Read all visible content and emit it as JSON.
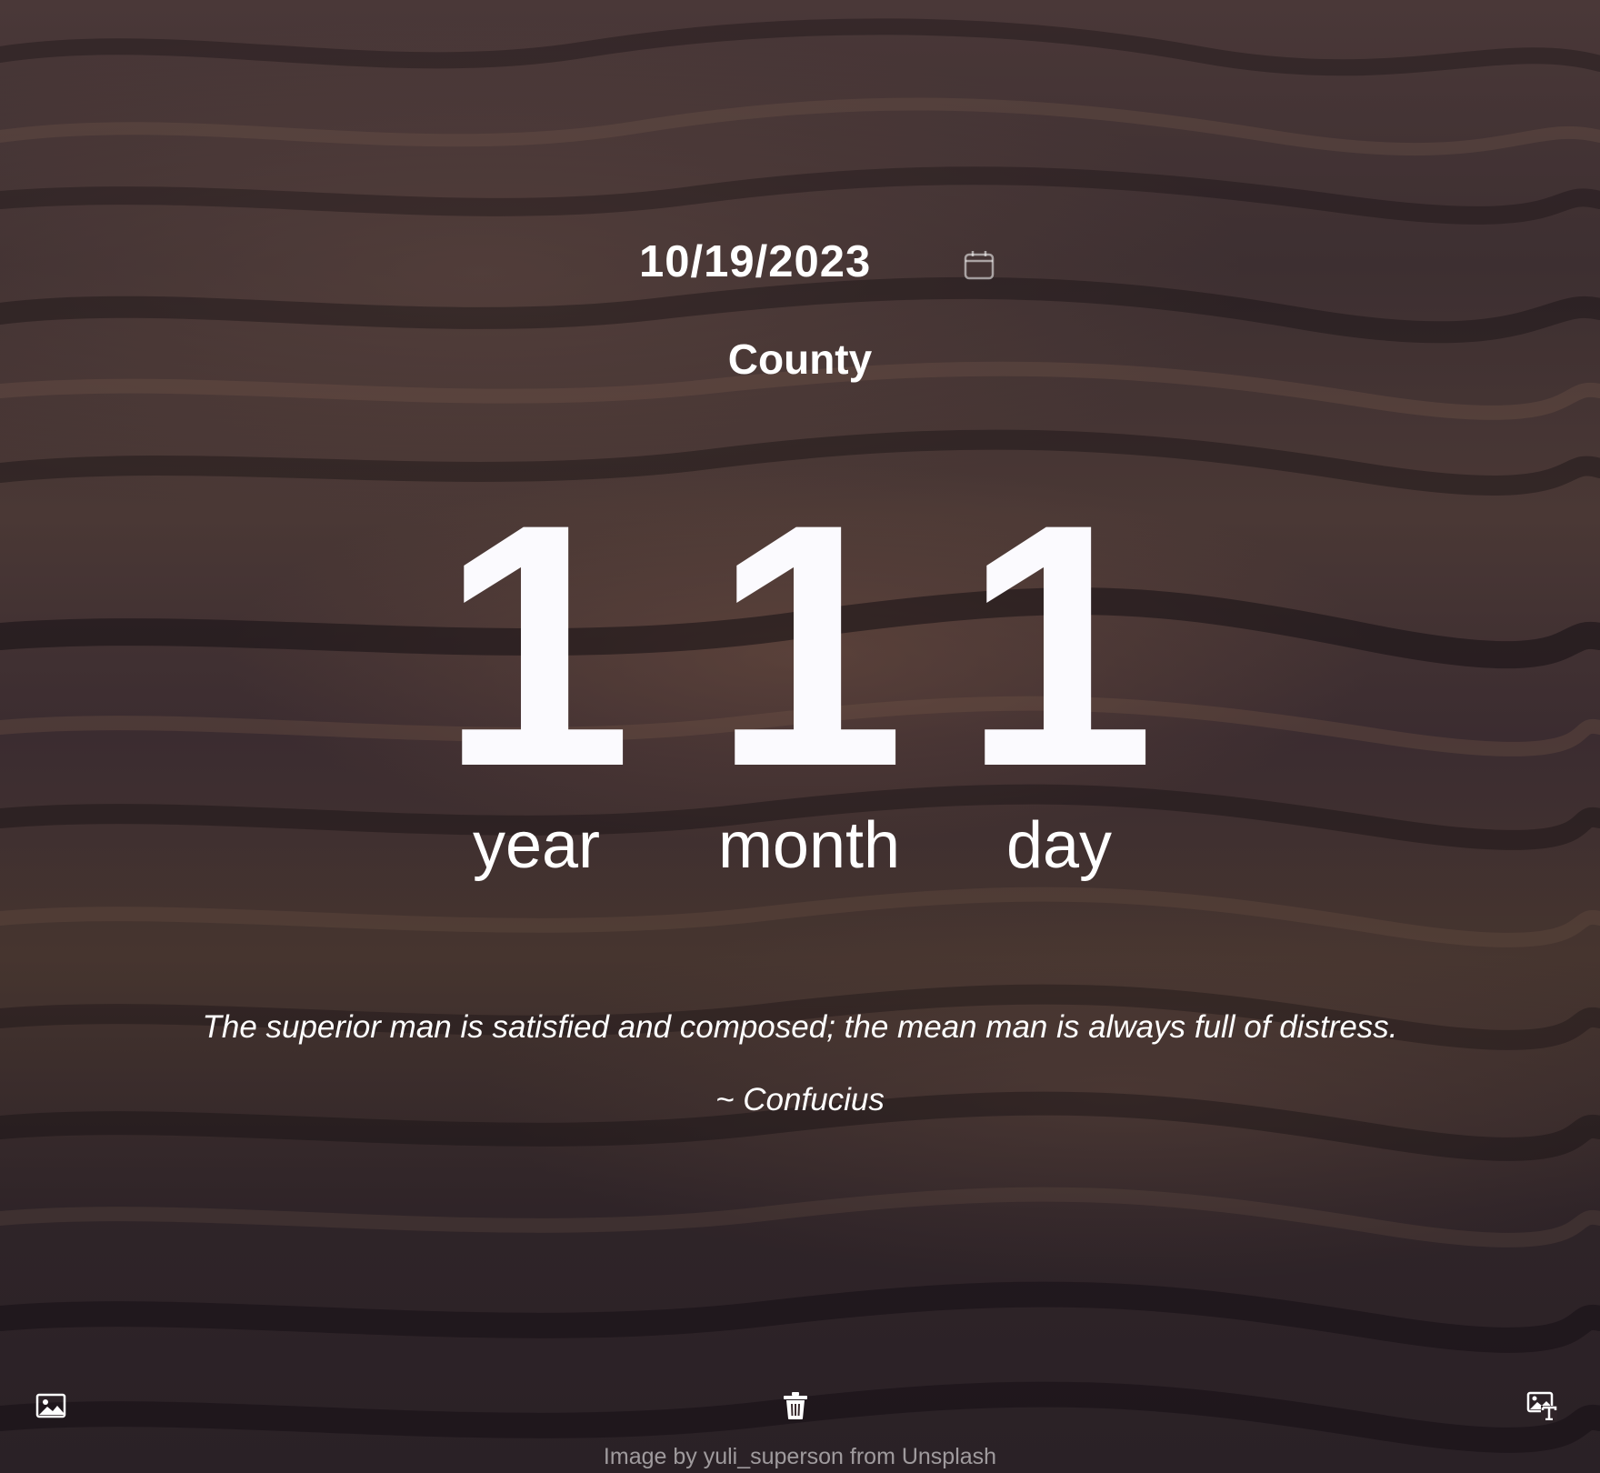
{
  "date_picker": {
    "value": "10/19/2023",
    "icon": "calendar-icon"
  },
  "title": "County",
  "counters": [
    {
      "value": "1",
      "unit": "year"
    },
    {
      "value": "1",
      "unit": "month"
    },
    {
      "value": "1",
      "unit": "day"
    }
  ],
  "quote": {
    "text": "The superior man is satisfied and composed; the mean man is always full of distress.",
    "author": "~ Confucius"
  },
  "toolbar": {
    "change_image_icon": "image-icon",
    "delete_icon": "trash-icon",
    "image_text_icon": "image-text-icon"
  },
  "credit": "Image by yuli_superson from Unsplash"
}
